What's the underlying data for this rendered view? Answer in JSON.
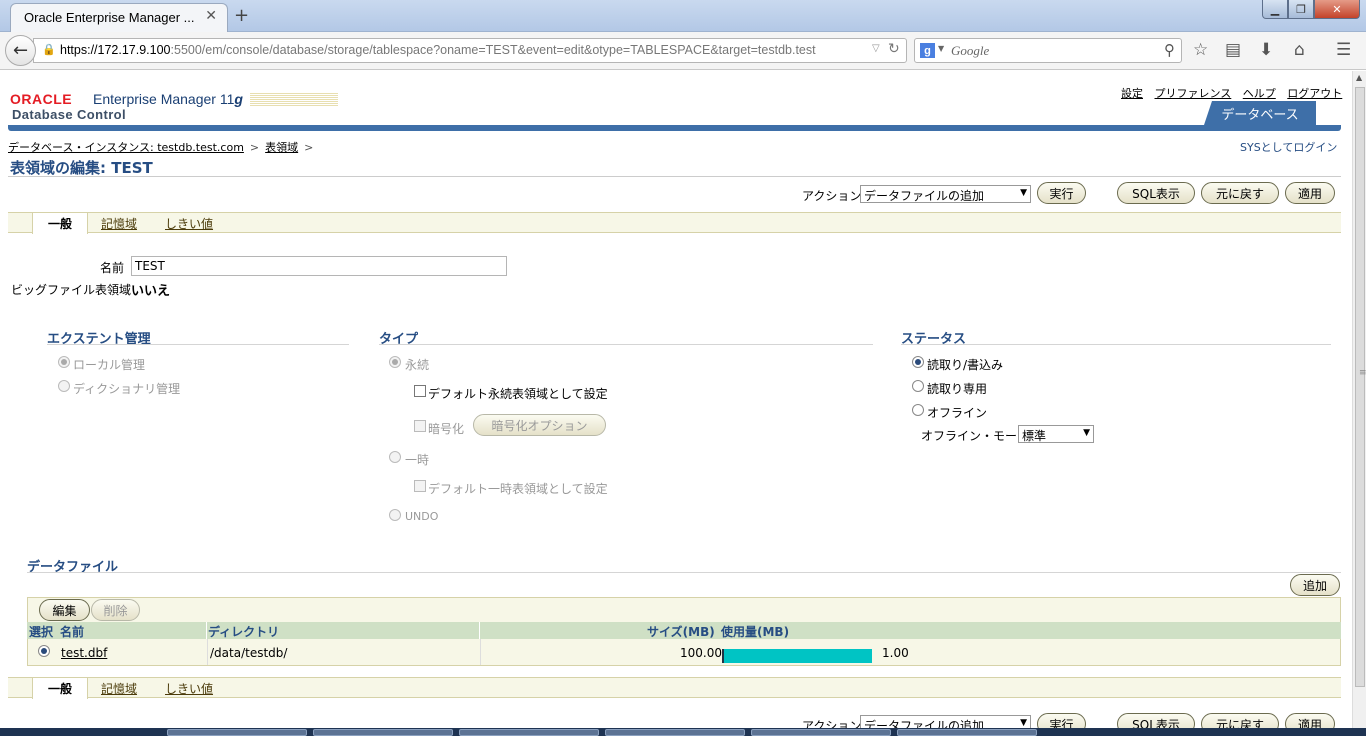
{
  "browser": {
    "tab_title": "Oracle Enterprise Manager ...",
    "url_host": "https://172.17.9.100",
    "url_path": ":5500/em/console/database/storage/tablespace?oname=TEST&event=edit&otype=TABLESPACE&target=testdb.test",
    "search_placeholder": "Google",
    "search_engine_letter": "g"
  },
  "header": {
    "oracle": "ORACLE",
    "em": "Enterprise Manager",
    "version": "11",
    "version_suffix": "g",
    "subtitle": "Database Control",
    "links": [
      "設定",
      "プリファレンス",
      "ヘルプ",
      "ログアウト"
    ],
    "db_tab": "データベース"
  },
  "breadcrumb": {
    "item1": "データベース・インスタンス: testdb.test.com",
    "item2": "表領域",
    "sep": ">"
  },
  "sys_login": "SYSとしてログイン",
  "page_title": "表領域の編集: TEST",
  "actions": {
    "label": "アクション",
    "selected": "データファイルの追加",
    "go": "実行",
    "sql": "SQL表示",
    "revert": "元に戻す",
    "apply": "適用"
  },
  "tabs": {
    "general": "一般",
    "storage": "記憶域",
    "thresholds": "しきい値"
  },
  "general": {
    "name_label": "名前",
    "name_value": "TEST",
    "bigfile_label": "ビッグファイル表領域",
    "bigfile_value": "いいえ"
  },
  "extent": {
    "title": "エクステント管理",
    "local": "ローカル管理",
    "dictionary": "ディクショナリ管理"
  },
  "type": {
    "title": "タイプ",
    "permanent": "永続",
    "default_permanent": "デフォルト永続表領域として設定",
    "encrypt": "暗号化",
    "encrypt_options": "暗号化オプション",
    "temporary": "一時",
    "default_temporary": "デフォルト一時表領域として設定",
    "undo": "UNDO"
  },
  "status": {
    "title": "ステータス",
    "read_write": "読取り/書込み",
    "read_only": "読取り専用",
    "offline": "オフライン",
    "offline_mode_label": "オフライン・モード",
    "offline_mode_value": "標準"
  },
  "datafiles": {
    "title": "データファイル",
    "add": "追加",
    "edit": "編集",
    "delete": "削除",
    "columns": {
      "select": "選択",
      "name": "名前",
      "directory": "ディレクトリ",
      "size": "サイズ(MB)",
      "usage": "使用量(MB)"
    },
    "rows": [
      {
        "name": "test.dbf",
        "directory": "/data/testdb/",
        "size": "100.00",
        "usage": "1.00",
        "usage_fraction": 1.0
      }
    ]
  }
}
